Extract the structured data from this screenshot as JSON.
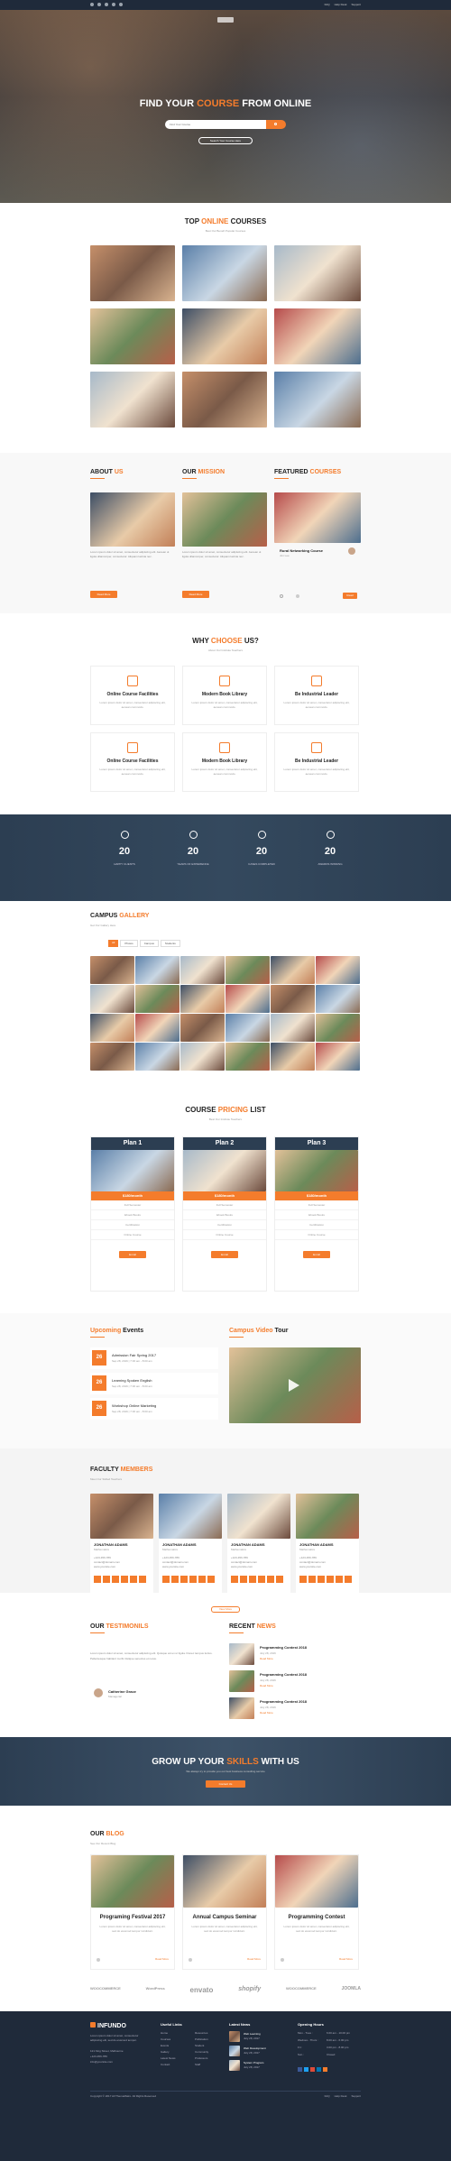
{
  "topbar": {
    "links": [
      "FAQ",
      "Help Desk",
      "Support"
    ]
  },
  "hero": {
    "title_a": "FIND YOUR ",
    "title_b": "COURSE",
    "title_c": " FROM ONLINE",
    "search_placeholder": "Find Your Course",
    "button": "Search Your Course Here"
  },
  "top_courses": {
    "title_a": "TOP ",
    "title_b": "ONLINE",
    "title_c": " COURSES",
    "sub": "Best Our Beneft Popular Courses"
  },
  "about": {
    "title_a": "ABOUT ",
    "title_b": "US",
    "body": "Lorem ipsum dolor sit amet, consectetur adipiscing elit. Aenean ut ligula ullamcorper, consectetur. Aliquam lacinia nec.",
    "button": "Read More"
  },
  "mission": {
    "title_a": "OUR ",
    "title_b": "MISSION",
    "body": "Lorem ipsum dolor sit amet, consectetur adipiscing elit. Aenean ut ligula ullamcorper, consectetur. Aliquam lacinia nec.",
    "button": "Read More"
  },
  "featured": {
    "title_a": "FEATURED ",
    "title_b": "COURSES",
    "course": "Rural Networking Course",
    "author": "Jon Lee",
    "button": "Read"
  },
  "why": {
    "title_a": "WHY ",
    "title_b": "CHOOSE",
    "title_c": " US?",
    "sub": "About Our Institute Teachers",
    "cards": [
      {
        "title": "Online Course Facilities",
        "body": "Lorem ipsum dolor sit amet, consectetur adipiscing elit, aenean commodo."
      },
      {
        "title": "Modern Book Library",
        "body": "Lorem ipsum dolor sit amet, consectetur adipiscing elit, aenean commodo."
      },
      {
        "title": "Be Industrial Leader",
        "body": "Lorem ipsum dolor sit amet, consectetur adipiscing elit, aenean commodo."
      },
      {
        "title": "Online Course Facilities",
        "body": "Lorem ipsum dolor sit amet, consectetur adipiscing elit, aenean commodo."
      },
      {
        "title": "Modern Book Library",
        "body": "Lorem ipsum dolor sit amet, consectetur adipiscing elit, aenean commodo."
      },
      {
        "title": "Be Industrial Leader",
        "body": "Lorem ipsum dolor sit amet, consectetur adipiscing elit, aenean commodo."
      }
    ]
  },
  "stats": [
    {
      "value": "20",
      "label": "HAPPY CLIENTS"
    },
    {
      "value": "20",
      "label": "YEARS OF EXPERIENCE"
    },
    {
      "value": "20",
      "label": "CASES COMPLETED"
    },
    {
      "value": "20",
      "label": "AWARDS WINNING"
    }
  ],
  "gallery": {
    "title_a": "CAMPUS ",
    "title_b": "GALLERY",
    "sub": "Get Our Gallery Here",
    "filters": [
      "All",
      "Photos",
      "Campus",
      "Students"
    ]
  },
  "pricing": {
    "title_a": "COURSE ",
    "title_b": "PRICING",
    "title_c": " LIST",
    "sub": "Best Our Institute Teachers",
    "plans": [
      {
        "name": "Plan 1",
        "price": "$180/month",
        "features": [
          "Full Semester",
          "Ebook Books",
          "Certification",
          "Online Course"
        ],
        "button": "Enroll"
      },
      {
        "name": "Plan 2",
        "price": "$180/month",
        "features": [
          "Full Semester",
          "Ebook Books",
          "Certification",
          "Online Course"
        ],
        "button": "Enroll"
      },
      {
        "name": "Plan 3",
        "price": "$180/month",
        "features": [
          "Full Semester",
          "Ebook Books",
          "Certification",
          "Online Course"
        ],
        "button": "Enroll"
      }
    ]
  },
  "events": {
    "title_a": "Upcoming",
    "title_b": " Events",
    "items": [
      {
        "day": "26",
        "title": "Admission Fair Spring 2017",
        "meta": "Sep 28, 2016 | 7:30 am - 8:00 am"
      },
      {
        "day": "26",
        "title": "Learning Spoken English",
        "meta": "Sep 28, 2016 | 7:30 am - 8:00 am"
      },
      {
        "day": "26",
        "title": "Workshop Online Marketing",
        "meta": "Sep 28, 2016 | 7:30 am - 8:00 am"
      }
    ]
  },
  "video": {
    "title_a": "Campus Video",
    "title_b": " Tour"
  },
  "faculty": {
    "title_a": "FACULTY ",
    "title_b": "MEMBERS",
    "sub": "Meet Our Skilled Teachers",
    "members": [
      {
        "name": "JONATHAN ADAMS",
        "role": "Mathematics"
      },
      {
        "name": "JONATHAN ADAMS",
        "role": "Mathematics"
      },
      {
        "name": "JONATHAN ADAMS",
        "role": "Mathematics"
      },
      {
        "name": "JONATHAN ADAMS",
        "role": "Mathematics"
      }
    ],
    "phone": "+123-456-789",
    "email": "contact@domain.com",
    "web": "www.yoursite.com",
    "button": "View More"
  },
  "testimonials": {
    "title_a": "OUR ",
    "title_b": "TESTIMONILS",
    "body": "Lorem ipsum dolor sit amet, consectetur adipiscing elit. Quisque vel ex ut ligula. Donec tempus luctus. Pellentesque habitant morbi tristique senectus et netus.",
    "name": "Catherine Grace",
    "role": "Managerial"
  },
  "news": {
    "title_a": "RECENT ",
    "title_b": "NEWS",
    "items": [
      {
        "title": "Programming Contest 2018",
        "date": "July 28, 2016",
        "more": "Read More"
      },
      {
        "title": "Programming Contest 2018",
        "date": "July 28, 2016",
        "more": "Read More"
      },
      {
        "title": "Programming Contest 2018",
        "date": "July 28, 2016",
        "more": "Read More"
      }
    ]
  },
  "cta": {
    "title_a": "GROW UP YOUR ",
    "title_b": "SKILLS",
    "title_c": " WITH US",
    "sub": "We always try to provide you our best business consulting service",
    "button": "Contact Us"
  },
  "blog": {
    "title_a": "OUR ",
    "title_b": "BLOG",
    "sub": "See Our Recent Blog",
    "posts": [
      {
        "title": "Programing Festival 2017",
        "body": "Lorem ipsum dolor sit amet, consectetur adipiscing elit, sed do eiusmod tempor incididunt.",
        "more": "Read More"
      },
      {
        "title": "Annual Campus Seminar",
        "body": "Lorem ipsum dolor sit amet, consectetur adipiscing elit, sed do eiusmod tempor incididunt.",
        "more": "Read More"
      },
      {
        "title": "Programming Contest",
        "body": "Lorem ipsum dolor sit amet, consectetur adipiscing elit, sed do eiusmod tempor incididunt.",
        "more": "Read More"
      }
    ]
  },
  "brands": [
    "WOOCOMMERCE",
    "WordPress",
    "envato",
    "shopify",
    "WOOCOMMERCE",
    "JOOMLA"
  ],
  "footer": {
    "logo": "INFUNDO",
    "about": "Lorem ipsum dolor sit amet, consectetur adipiscing elit, sed do eiusmod tempor.",
    "address": "121 King Street, Melbourne",
    "phone": "+123-456-789",
    "email": "info@yoursite.com",
    "useful_title": "Useful Links",
    "useful_a": [
      "Home",
      "Courses",
      "Events",
      "Gallery",
      "Latest News",
      "Contact"
    ],
    "useful_b": [
      "Resources",
      "Publication",
      "Student",
      "Community",
      "Professors",
      "Staff"
    ],
    "news_title": "Latest News",
    "news": [
      {
        "title": "Web Learning",
        "date": "July 28, 2017"
      },
      {
        "title": "Web Development",
        "date": "July 28, 2017"
      },
      {
        "title": "System Program",
        "date": "July 28, 2017"
      }
    ],
    "hours_title": "Opening Hours",
    "hours": [
      {
        "d": "Mon - Tues :",
        "t": "6.00 am - 10.00 pm"
      },
      {
        "d": "Wednes - Thurs :",
        "t": "8.00 am - 6.00 pm"
      },
      {
        "d": "Fri :",
        "t": "3.00 pm - 8.00 pm"
      },
      {
        "d": "Sun :",
        "t": "Closed"
      }
    ],
    "copyright": "Copyright © 2017 All ThemeMatro. All Rights Reserved",
    "bottom_links": [
      "FAQ",
      "Help Desk",
      "Support"
    ]
  },
  "colors": {
    "accent": "#f47c2c",
    "dark": "#2c3e52",
    "footer": "#1f2a3a"
  }
}
